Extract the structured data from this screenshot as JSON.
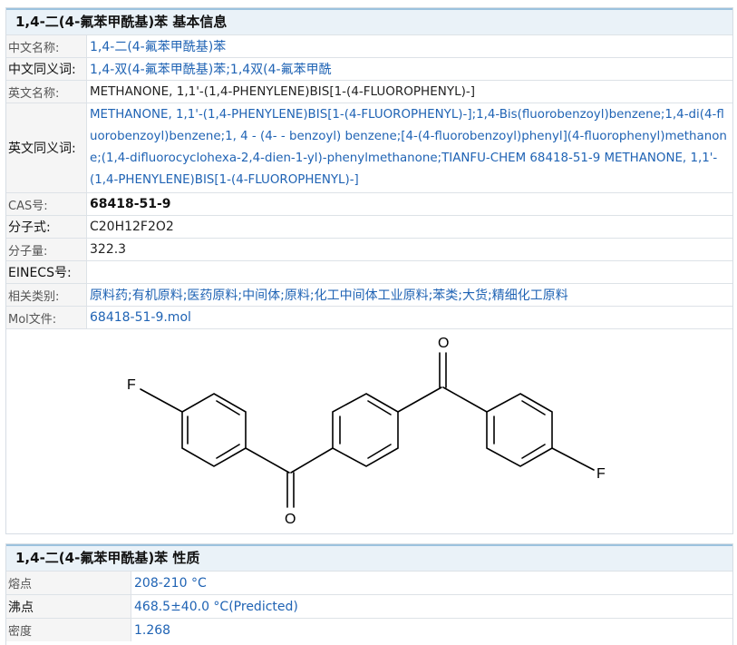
{
  "basic": {
    "title": "1,4-二(4-氟苯甲酰基)苯 基本信息",
    "rows": [
      {
        "label": "中文名称:",
        "value": "1,4-二(4-氟苯甲酰基)苯"
      },
      {
        "label": "中文同义词:",
        "value": "1,4-双(4-氟苯甲酰基)苯;1,4双(4-氟苯甲酰"
      },
      {
        "label": "英文名称:",
        "value": "METHANONE, 1,1'-(1,4-PHENYLENE)BIS[1-(4-FLUOROPHENYL)-]"
      },
      {
        "label": "英文同义词:",
        "value_lines": [
          "METHANONE, 1,1'-(1,4-PHENYLENE)BIS[1-(4-FLUOROPHENYL)-];1,4-Bis(fluorobenzoyl)benzene;1,4-di(4-fluorobenzoyl)benzene;1, 4 - (4- - benzoyl) benzene;[4-(4-fluorobenzoyl)phenyl](4-fluorophenyl)methanone;(1,4-difluorocyclohexa-2,4-dien-1-yl)-phenylmethanone;TIANFU-CHEM 68418-51-9 METHANONE, 1,1'-(1,4-PHENYLENE)BIS[1-(4-FLUOROPHENYL)-]"
        ]
      },
      {
        "label": "CAS号:",
        "value": "68418-51-9"
      },
      {
        "label": "分子式:",
        "value": "C20H12F2O2"
      },
      {
        "label": "分子量:",
        "value": "322.3"
      },
      {
        "label": "EINECS号:",
        "value": ""
      },
      {
        "label": "相关类别:",
        "value": "原料药;有机原料;医药原料;中间体;原料;化工中间体工业原料;苯类;大货;精细化工原料"
      },
      {
        "label": "Mol文件:",
        "value": "68418-51-9.mol"
      }
    ],
    "structure_atoms": {
      "F1": "F",
      "F2": "F",
      "O1": "O",
      "O2": "O"
    }
  },
  "props": {
    "title": "1,4-二(4-氟苯甲酰基)苯 性质",
    "rows": [
      {
        "label": "熔点",
        "value": "208-210 °C"
      },
      {
        "label": "沸点",
        "value": "468.5±40.0 °C(Predicted)"
      },
      {
        "label": "密度",
        "value": "1.268"
      }
    ]
  },
  "colors": {
    "link": "#1f63b4",
    "header_bg": "#eaf2f8",
    "header_border": "#9cc2de"
  }
}
